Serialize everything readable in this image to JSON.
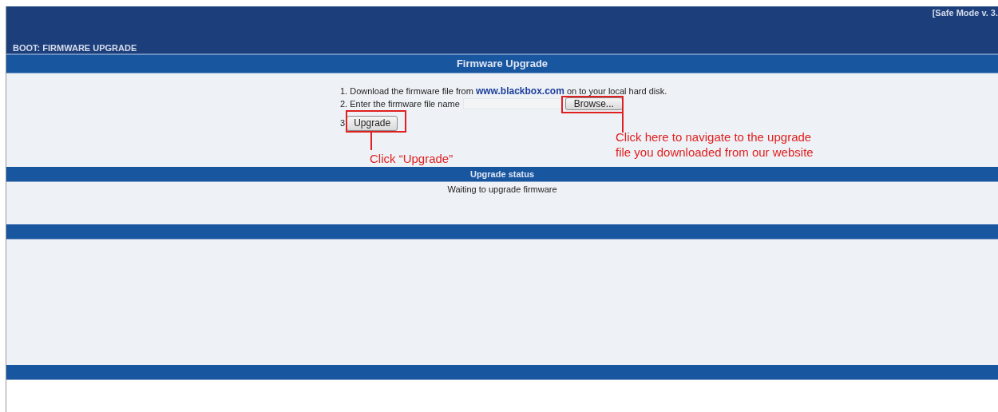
{
  "header": {
    "mode": "[Safe Mode v. 3.",
    "page_title": "BOOT: FIRMWARE UPGRADE"
  },
  "upgrade": {
    "title": "Firmware Upgrade",
    "step1": {
      "before": "1. Download the firmware file from",
      "link": "www.blackbox.com",
      "after": "on to your local hard disk."
    },
    "step2": {
      "label": "2. Enter the firmware file name",
      "browse": "Browse..."
    },
    "step3": {
      "number": "3",
      "button": "Upgrade"
    }
  },
  "annotations": [
    {
      "lines": [
        "Click “Upgrade”"
      ]
    },
    {
      "lines": [
        "Click here to navigate to the upgrade",
        "file you downloaded from our website"
      ]
    }
  ],
  "status": {
    "title": "Upgrade status",
    "message": "Waiting to upgrade firmware"
  }
}
